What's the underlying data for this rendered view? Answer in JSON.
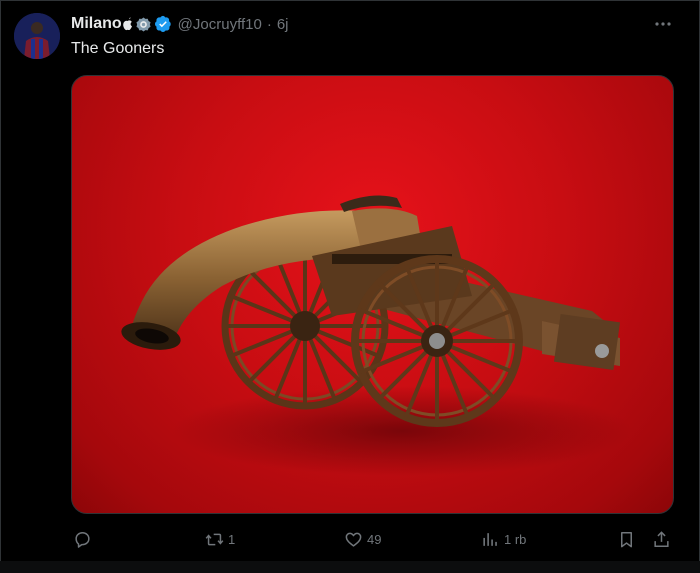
{
  "tweet": {
    "display_name": "Milano",
    "handle": "@Jocruyff10",
    "separator": "·",
    "time": "6j",
    "text": "The Gooners"
  },
  "actions": {
    "retweets": "1",
    "likes": "49",
    "views": "1 rb"
  },
  "colors": {
    "background": "#000000",
    "primary_text": "#e7e9ea",
    "secondary_text": "#71767b",
    "verified_blue": "#1d9bf0",
    "media_red": "#d10f16"
  },
  "icons": [
    "apple-icon",
    "affiliate-badge-icon",
    "verified-badge-icon",
    "more-icon",
    "reply-icon",
    "retweet-icon",
    "like-icon",
    "views-icon",
    "bookmark-icon",
    "share-icon"
  ]
}
